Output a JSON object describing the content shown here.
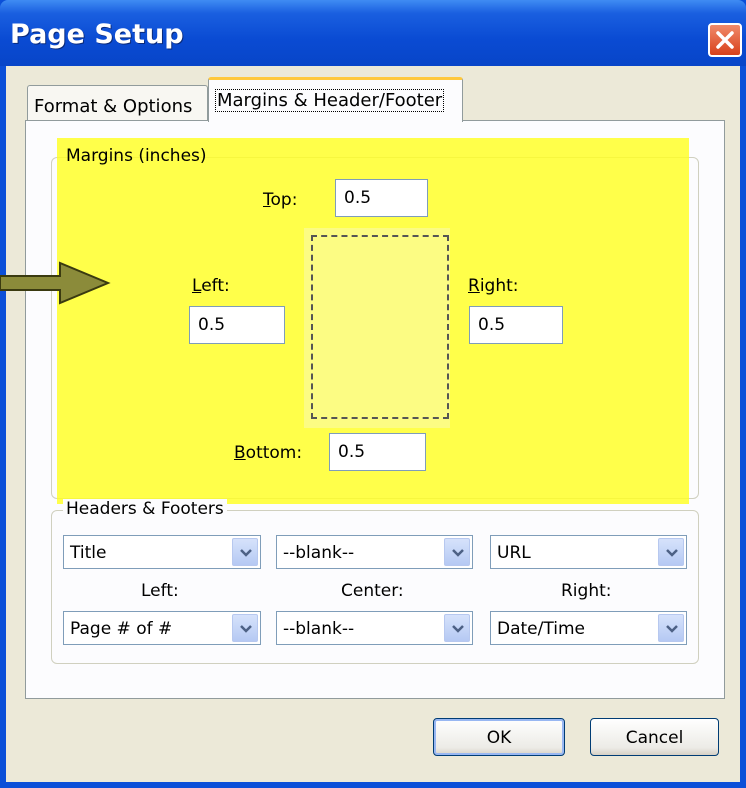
{
  "dialog": {
    "title": "Page Setup"
  },
  "tabs": [
    {
      "label": "Format & Options"
    },
    {
      "label": "Margins & Header/Footer"
    }
  ],
  "margins": {
    "group_label": "Margins (inches)",
    "top_prefix": "",
    "top_label_mnemonic": "T",
    "top_label_rest": "op:",
    "top_value": "0.5",
    "left_label_mnemonic": "L",
    "left_label_rest": "eft:",
    "left_value": "0.5",
    "right_label_mnemonic": "R",
    "right_label_rest": "ight:",
    "right_value": "0.5",
    "bottom_label_mnemonic": "B",
    "bottom_label_rest": "ottom:",
    "bottom_value": "0.5",
    "highlight_color": "#ffff22"
  },
  "headers_footers": {
    "group_label": "Headers & Footers",
    "header_left": "Title",
    "header_center": "--blank--",
    "header_right": "URL",
    "col_left": "Left:",
    "col_center": "Center:",
    "col_right": "Right:",
    "footer_left": "Page # of #",
    "footer_center": "--blank--",
    "footer_right": "Date/Time"
  },
  "buttons": {
    "ok": "OK",
    "cancel": "Cancel"
  },
  "annotation": {
    "arrow_color": "#8b8b3a"
  }
}
